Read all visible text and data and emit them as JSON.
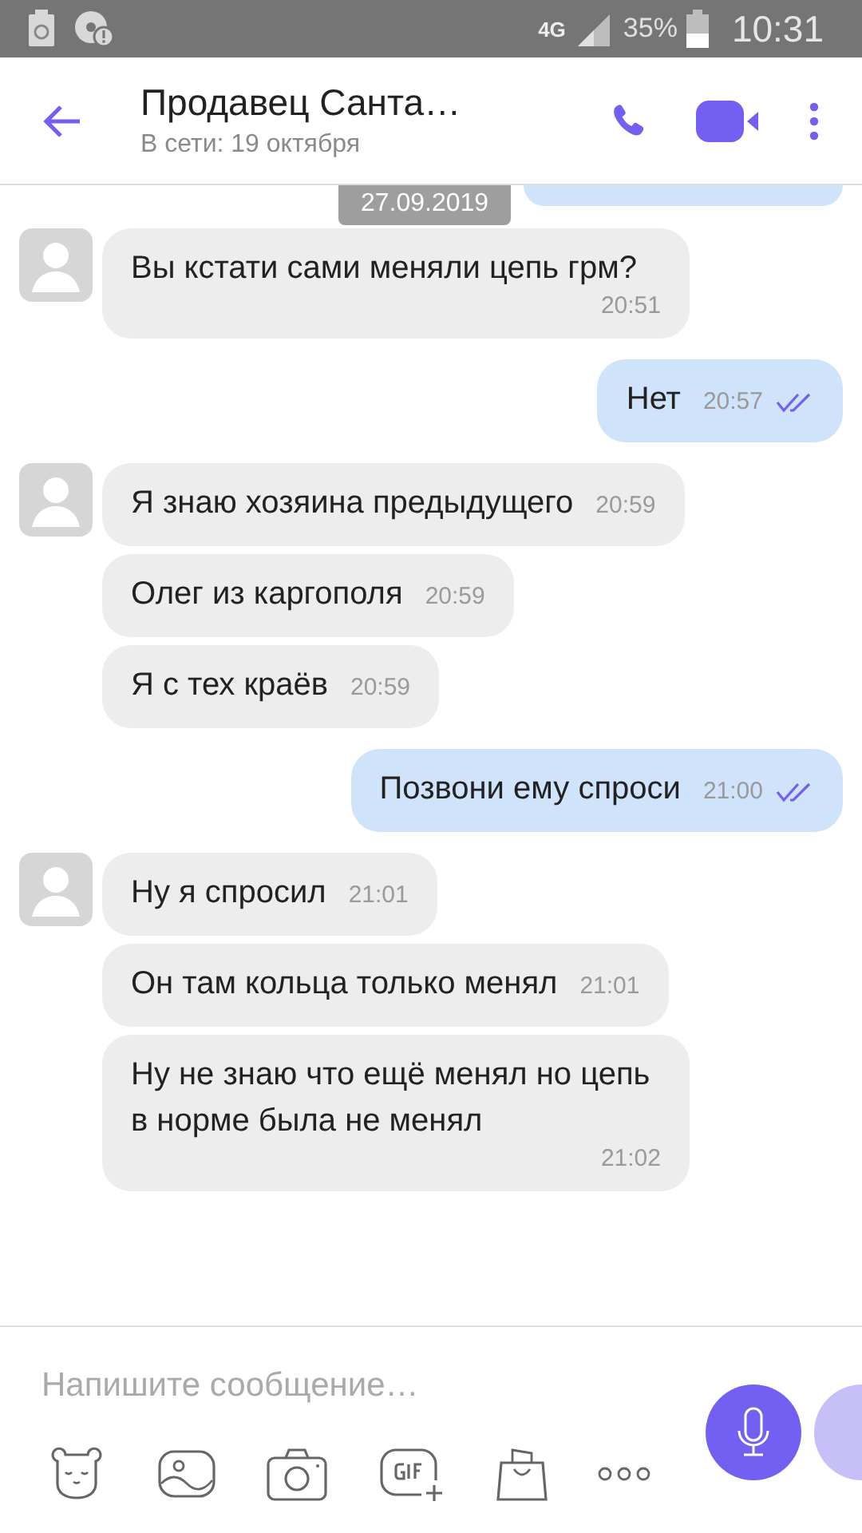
{
  "status_bar": {
    "network": "4G",
    "battery": "35%",
    "time": "10:31"
  },
  "header": {
    "title": "Продавец Санта…",
    "subtitle": "В сети: 19 октября"
  },
  "date_chip": "27.09.2019",
  "messages": [
    {
      "kind": "incoming",
      "avatar": true,
      "text": "Вы кстати сами меняли цепь грм?",
      "time": "20:51"
    },
    {
      "kind": "outgoing",
      "text": "Нет",
      "time": "20:57",
      "read": true
    },
    {
      "kind": "incoming",
      "avatar": true,
      "text": "Я знаю хозяина предыдущего",
      "time": "20:59"
    },
    {
      "kind": "incoming",
      "avatar": false,
      "text": "Олег из каргополя",
      "time": "20:59"
    },
    {
      "kind": "incoming",
      "avatar": false,
      "text": "Я с тех краёв",
      "time": "20:59"
    },
    {
      "kind": "outgoing",
      "text": "Позвони ему спроси",
      "time": "21:00",
      "read": true
    },
    {
      "kind": "incoming",
      "avatar": true,
      "text": "Ну я спросил",
      "time": "21:01"
    },
    {
      "kind": "incoming",
      "avatar": false,
      "text": "Он там кольца только менял",
      "time": "21:01"
    },
    {
      "kind": "incoming",
      "avatar": false,
      "text": "Ну не знаю что ещё менял но цепь в норме была не менял",
      "time": "21:02"
    }
  ],
  "composer": {
    "placeholder": "Напишите сообщение…"
  }
}
